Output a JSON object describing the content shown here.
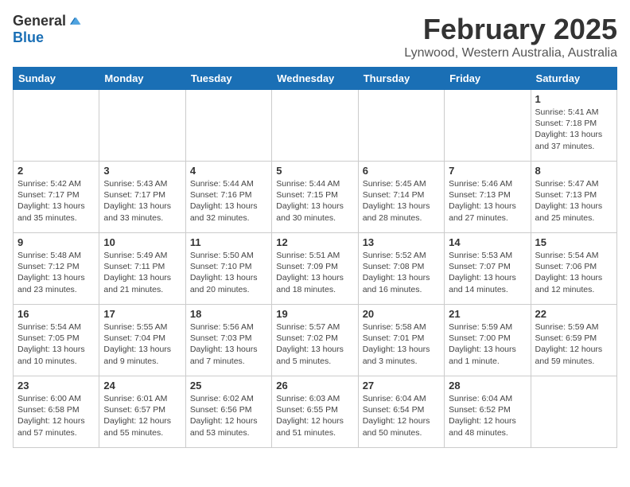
{
  "logo": {
    "general": "General",
    "blue": "Blue"
  },
  "title": "February 2025",
  "subtitle": "Lynwood, Western Australia, Australia",
  "headers": [
    "Sunday",
    "Monday",
    "Tuesday",
    "Wednesday",
    "Thursday",
    "Friday",
    "Saturday"
  ],
  "weeks": [
    [
      {
        "day": "",
        "info": ""
      },
      {
        "day": "",
        "info": ""
      },
      {
        "day": "",
        "info": ""
      },
      {
        "day": "",
        "info": ""
      },
      {
        "day": "",
        "info": ""
      },
      {
        "day": "",
        "info": ""
      },
      {
        "day": "1",
        "info": "Sunrise: 5:41 AM\nSunset: 7:18 PM\nDaylight: 13 hours\nand 37 minutes."
      }
    ],
    [
      {
        "day": "2",
        "info": "Sunrise: 5:42 AM\nSunset: 7:17 PM\nDaylight: 13 hours\nand 35 minutes."
      },
      {
        "day": "3",
        "info": "Sunrise: 5:43 AM\nSunset: 7:17 PM\nDaylight: 13 hours\nand 33 minutes."
      },
      {
        "day": "4",
        "info": "Sunrise: 5:44 AM\nSunset: 7:16 PM\nDaylight: 13 hours\nand 32 minutes."
      },
      {
        "day": "5",
        "info": "Sunrise: 5:44 AM\nSunset: 7:15 PM\nDaylight: 13 hours\nand 30 minutes."
      },
      {
        "day": "6",
        "info": "Sunrise: 5:45 AM\nSunset: 7:14 PM\nDaylight: 13 hours\nand 28 minutes."
      },
      {
        "day": "7",
        "info": "Sunrise: 5:46 AM\nSunset: 7:13 PM\nDaylight: 13 hours\nand 27 minutes."
      },
      {
        "day": "8",
        "info": "Sunrise: 5:47 AM\nSunset: 7:13 PM\nDaylight: 13 hours\nand 25 minutes."
      }
    ],
    [
      {
        "day": "9",
        "info": "Sunrise: 5:48 AM\nSunset: 7:12 PM\nDaylight: 13 hours\nand 23 minutes."
      },
      {
        "day": "10",
        "info": "Sunrise: 5:49 AM\nSunset: 7:11 PM\nDaylight: 13 hours\nand 21 minutes."
      },
      {
        "day": "11",
        "info": "Sunrise: 5:50 AM\nSunset: 7:10 PM\nDaylight: 13 hours\nand 20 minutes."
      },
      {
        "day": "12",
        "info": "Sunrise: 5:51 AM\nSunset: 7:09 PM\nDaylight: 13 hours\nand 18 minutes."
      },
      {
        "day": "13",
        "info": "Sunrise: 5:52 AM\nSunset: 7:08 PM\nDaylight: 13 hours\nand 16 minutes."
      },
      {
        "day": "14",
        "info": "Sunrise: 5:53 AM\nSunset: 7:07 PM\nDaylight: 13 hours\nand 14 minutes."
      },
      {
        "day": "15",
        "info": "Sunrise: 5:54 AM\nSunset: 7:06 PM\nDaylight: 13 hours\nand 12 minutes."
      }
    ],
    [
      {
        "day": "16",
        "info": "Sunrise: 5:54 AM\nSunset: 7:05 PM\nDaylight: 13 hours\nand 10 minutes."
      },
      {
        "day": "17",
        "info": "Sunrise: 5:55 AM\nSunset: 7:04 PM\nDaylight: 13 hours\nand 9 minutes."
      },
      {
        "day": "18",
        "info": "Sunrise: 5:56 AM\nSunset: 7:03 PM\nDaylight: 13 hours\nand 7 minutes."
      },
      {
        "day": "19",
        "info": "Sunrise: 5:57 AM\nSunset: 7:02 PM\nDaylight: 13 hours\nand 5 minutes."
      },
      {
        "day": "20",
        "info": "Sunrise: 5:58 AM\nSunset: 7:01 PM\nDaylight: 13 hours\nand 3 minutes."
      },
      {
        "day": "21",
        "info": "Sunrise: 5:59 AM\nSunset: 7:00 PM\nDaylight: 13 hours\nand 1 minute."
      },
      {
        "day": "22",
        "info": "Sunrise: 5:59 AM\nSunset: 6:59 PM\nDaylight: 12 hours\nand 59 minutes."
      }
    ],
    [
      {
        "day": "23",
        "info": "Sunrise: 6:00 AM\nSunset: 6:58 PM\nDaylight: 12 hours\nand 57 minutes."
      },
      {
        "day": "24",
        "info": "Sunrise: 6:01 AM\nSunset: 6:57 PM\nDaylight: 12 hours\nand 55 minutes."
      },
      {
        "day": "25",
        "info": "Sunrise: 6:02 AM\nSunset: 6:56 PM\nDaylight: 12 hours\nand 53 minutes."
      },
      {
        "day": "26",
        "info": "Sunrise: 6:03 AM\nSunset: 6:55 PM\nDaylight: 12 hours\nand 51 minutes."
      },
      {
        "day": "27",
        "info": "Sunrise: 6:04 AM\nSunset: 6:54 PM\nDaylight: 12 hours\nand 50 minutes."
      },
      {
        "day": "28",
        "info": "Sunrise: 6:04 AM\nSunset: 6:52 PM\nDaylight: 12 hours\nand 48 minutes."
      },
      {
        "day": "",
        "info": ""
      }
    ]
  ]
}
